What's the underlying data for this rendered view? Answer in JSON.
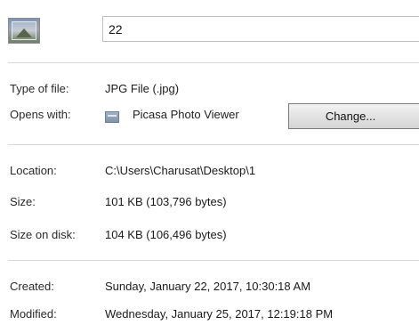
{
  "file": {
    "name": "22",
    "icon": "image-file-icon"
  },
  "fields": {
    "type_label": "Type of file:",
    "type_value": "JPG File (.jpg)",
    "opens_label": "Opens with:",
    "opens_app": "Picasa Photo Viewer",
    "opens_app_icon": "picasa-photo-viewer-icon",
    "change_button": "Change...",
    "location_label": "Location:",
    "location_value": "C:\\Users\\Charusat\\Desktop\\1",
    "size_label": "Size:",
    "size_value": "101 KB (103,796 bytes)",
    "size_on_disk_label": "Size on disk:",
    "size_on_disk_value": "104 KB (106,496 bytes)",
    "created_label": "Created:",
    "created_value": "Sunday, January 22, 2017, 10:30:18 AM",
    "modified_label": "Modified:",
    "modified_value": "Wednesday, January 25, 2017, 12:19:18 PM"
  }
}
